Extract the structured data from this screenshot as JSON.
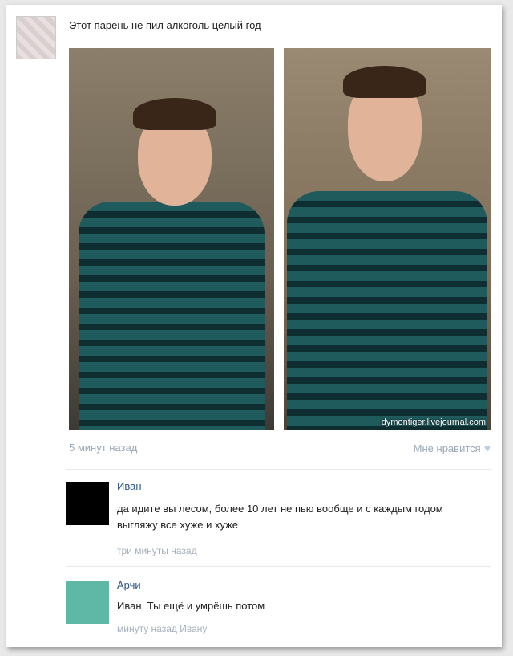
{
  "post": {
    "title": "Этот парень не пил алкоголь целый год",
    "time": "5 минут назад",
    "like_label": "Мне нравится",
    "watermark": "dymontiger.livejournal.com"
  },
  "comments": [
    {
      "author": "Иван",
      "text": "да идите вы лесом, более 10 лет не пью вообще и с каждым годом выгляжу все хуже и хуже",
      "time": "три минуты назад",
      "avatar_color": "#000000"
    },
    {
      "author": "Арчи",
      "text": "Иван, Ты ещё и умрёшь потом",
      "time": "минуту назад Ивану",
      "avatar_color": "#5fb8a6"
    }
  ],
  "colors": {
    "link": "#2b5788",
    "muted": "#9aa7b6"
  }
}
